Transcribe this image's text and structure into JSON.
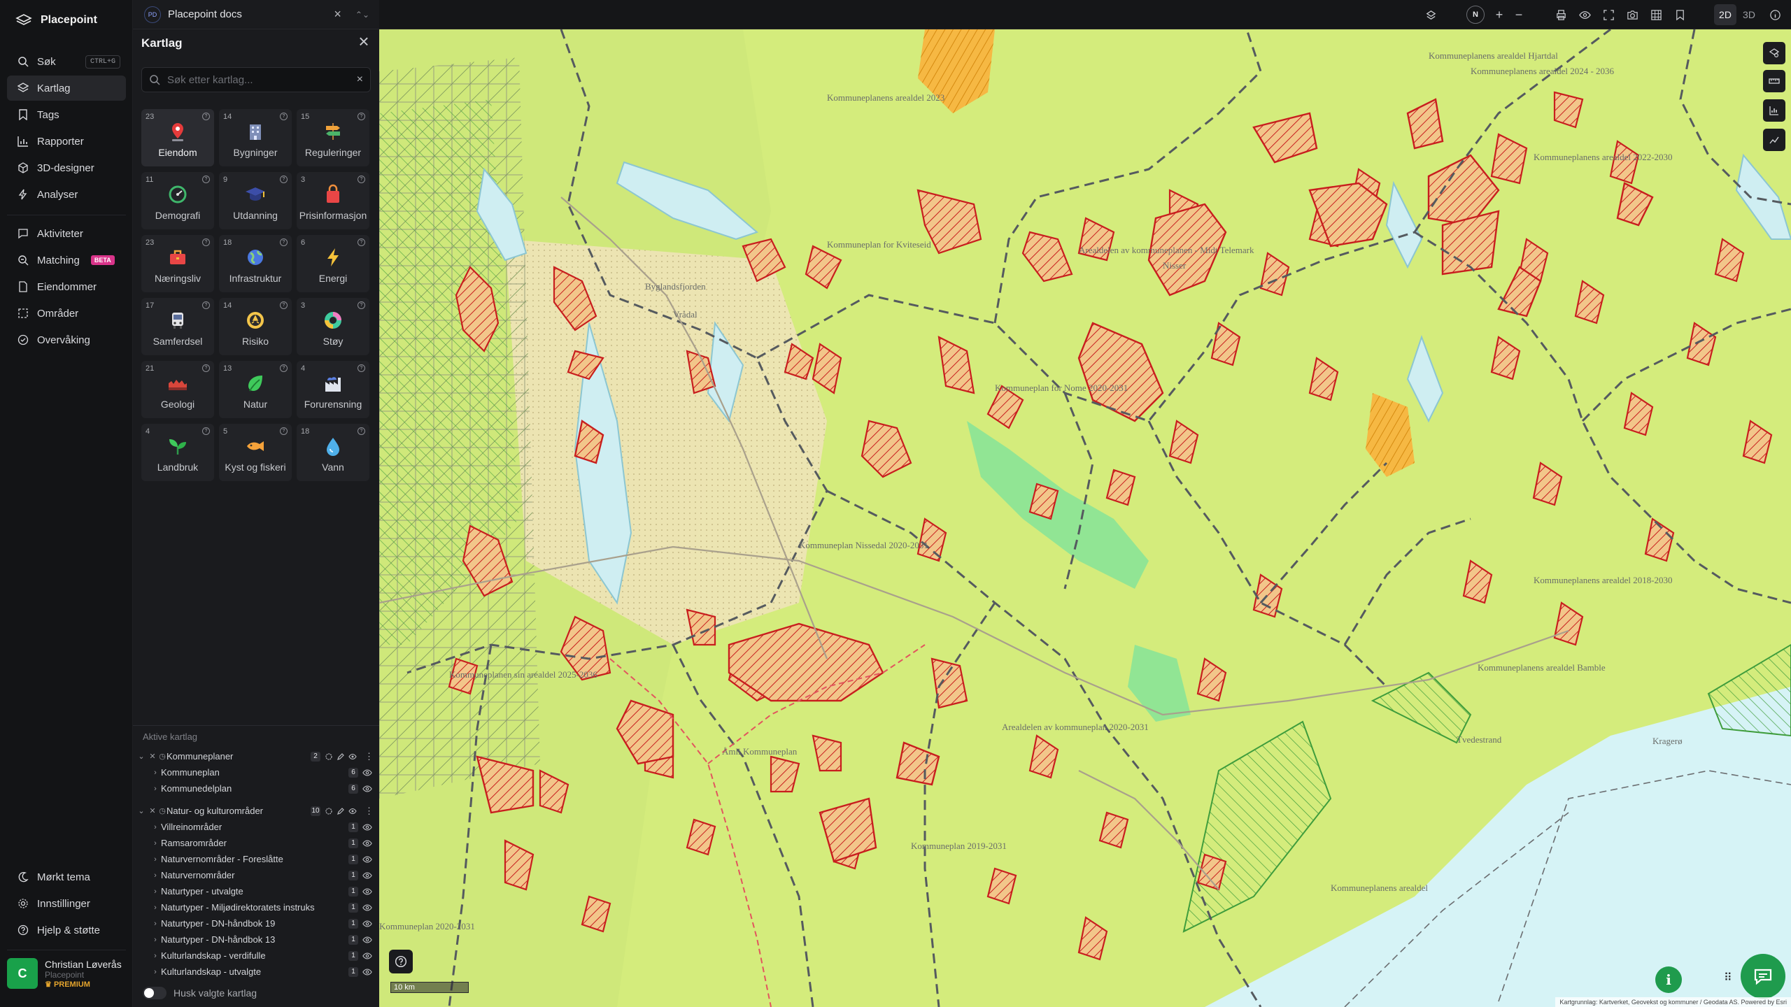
{
  "brand": {
    "name": "Placepoint"
  },
  "nav": {
    "items": [
      {
        "label": "Søk",
        "shortcut": "CTRL+G"
      },
      {
        "label": "Kartlag"
      },
      {
        "label": "Tags"
      },
      {
        "label": "Rapporter"
      },
      {
        "label": "3D-designer"
      },
      {
        "label": "Analyser"
      },
      {
        "label": "Aktiviteter"
      },
      {
        "label": "Matching",
        "badge": "BETA"
      },
      {
        "label": "Eiendommer"
      },
      {
        "label": "Områder"
      },
      {
        "label": "Overvåking"
      }
    ],
    "bottom": [
      {
        "label": "Mørkt tema"
      },
      {
        "label": "Innstillinger"
      },
      {
        "label": "Hjelp & støtte"
      }
    ]
  },
  "user": {
    "initial": "C",
    "name": "Christian Løverås",
    "org": "Placepoint",
    "plan": "PREMIUM"
  },
  "tab": {
    "badge": "PD",
    "title": "Placepoint docs"
  },
  "panel": {
    "title": "Kartlag",
    "search_placeholder": "Søk etter kartlag..."
  },
  "categories": [
    {
      "count": "23",
      "label": "Eiendom",
      "icon": "location-pin-icon"
    },
    {
      "count": "14",
      "label": "Bygninger",
      "icon": "building-icon"
    },
    {
      "count": "15",
      "label": "Reguleringer",
      "icon": "signpost-icon"
    },
    {
      "count": "11",
      "label": "Demografi",
      "icon": "gauge-icon"
    },
    {
      "count": "9",
      "label": "Utdanning",
      "icon": "graduation-cap-icon"
    },
    {
      "count": "3",
      "label": "Prisinformasjon",
      "icon": "shopping-bag-icon"
    },
    {
      "count": "23",
      "label": "Næringsliv",
      "icon": "briefcase-icon"
    },
    {
      "count": "18",
      "label": "Infrastruktur",
      "icon": "globe-icon"
    },
    {
      "count": "6",
      "label": "Energi",
      "icon": "lightning-icon"
    },
    {
      "count": "17",
      "label": "Samferdsel",
      "icon": "bus-icon"
    },
    {
      "count": "14",
      "label": "Risiko",
      "icon": "hazard-icon"
    },
    {
      "count": "3",
      "label": "Støy",
      "icon": "noise-ring-icon"
    },
    {
      "count": "21",
      "label": "Geologi",
      "icon": "terrain-icon"
    },
    {
      "count": "13",
      "label": "Natur",
      "icon": "leaf-icon"
    },
    {
      "count": "4",
      "label": "Forurensning",
      "icon": "factory-icon"
    },
    {
      "count": "4",
      "label": "Landbruk",
      "icon": "sprout-icon"
    },
    {
      "count": "5",
      "label": "Kyst og fiskeri",
      "icon": "fish-icon"
    },
    {
      "count": "18",
      "label": "Vann",
      "icon": "water-drop-icon"
    }
  ],
  "active_layers": {
    "title": "Aktive kartlag",
    "groups": [
      {
        "name": "Kommuneplaner",
        "count": "2",
        "children": [
          {
            "name": "Kommuneplan",
            "count": "6"
          },
          {
            "name": "Kommunedelplan",
            "count": "6"
          }
        ]
      },
      {
        "name": "Natur- og kulturområder",
        "count": "10",
        "children": [
          {
            "name": "Villreinområder",
            "count": "1"
          },
          {
            "name": "Ramsarområder",
            "count": "1"
          },
          {
            "name": "Naturvernområder - Foreslåtte",
            "count": "1"
          },
          {
            "name": "Naturvernområder",
            "count": "1"
          },
          {
            "name": "Naturtyper - utvalgte",
            "count": "1"
          },
          {
            "name": "Naturtyper - Miljødirektoratets instruks",
            "count": "1"
          },
          {
            "name": "Naturtyper - DN-håndbok 19",
            "count": "1"
          },
          {
            "name": "Naturtyper - DN-håndbok 13",
            "count": "1"
          },
          {
            "name": "Kulturlandskap - verdifulle",
            "count": "1"
          },
          {
            "name": "Kulturlandskap - utvalgte",
            "count": "1"
          }
        ]
      }
    ],
    "remember_label": "Husk valgte kartlag"
  },
  "toolbar": {
    "view_2d": "2D",
    "view_3d": "3D",
    "compass": "N",
    "zoom_in": "+",
    "zoom_out": "−"
  },
  "map": {
    "scale": "10 km",
    "attribution": "Kartgrunnlag: Kartverket, Geovekst og kommuner / Geodata AS. Powered by Esri",
    "labels": [
      "Kommuneplanens arealdel Hjartdal",
      "Kommuneplanens arealdel 2023",
      "Kommuneplan for Kviteseid",
      "Kommuneplan for Nome 2020-2031",
      "Kommuneplan Nissedal 2020-2031",
      "Kommuneplanens arealdel 2024 - 2036",
      "Kommuneplanens arealdel 2022-2030",
      "Arealdelen av kommuneplanen - Midt Telemark",
      "Kommuneplanens arealdel 2018-2030",
      "Kommuneplanens arealdel Bamble",
      "Arealdelen av kommuneplan 2020-2031",
      "Kommuneplanen sin arealdel 2025-2036",
      "Åmli Kommuneplan",
      "Kommuneplan 2019-2031",
      "Kommuneplanens arealdel",
      "Kommuneplan 2020-2031",
      "Byglandsfjorden",
      "Nisser",
      "Vrådal",
      "Kragerø",
      "Tvedestrand"
    ]
  }
}
